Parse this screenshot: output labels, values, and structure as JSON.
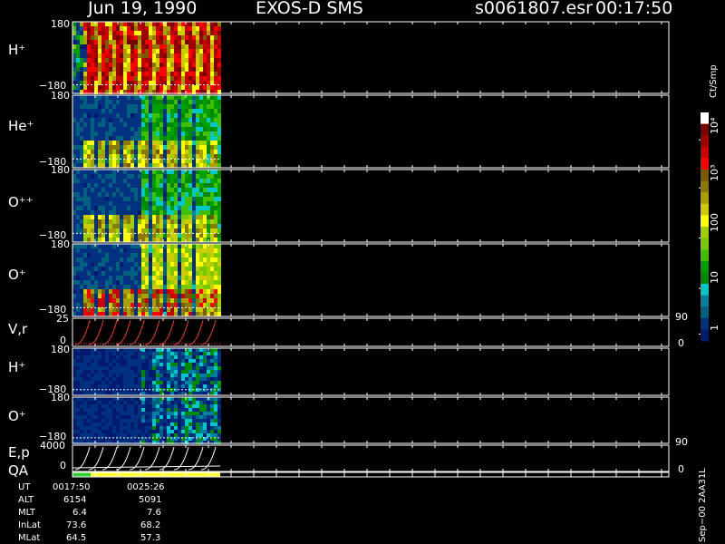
{
  "header": {
    "date": "Jun 19, 1990",
    "instrument": "EXOS-D SMS",
    "file": "s0061807.esr",
    "time": "00:17:50"
  },
  "colorbar": {
    "unit": "Ct/Smp",
    "labels": [
      "10⁴",
      "10³",
      "100",
      "10",
      "1"
    ],
    "colors": [
      "#ffffff",
      "#7a0000",
      "#a00000",
      "#cc0000",
      "#ff0000",
      "#7a5a00",
      "#8c7a00",
      "#aaa000",
      "#cccc00",
      "#ffff00",
      "#a0d000",
      "#7ac800",
      "#40c000",
      "#00a000",
      "#008800",
      "#00c8c8",
      "#0080a0",
      "#006080",
      "#003080",
      "#001a6e"
    ]
  },
  "panels": [
    {
      "id": "h-plus",
      "label": "H⁺",
      "ymax": "180",
      "ymin": "−180"
    },
    {
      "id": "he-plus",
      "label": "He⁺",
      "ymax": "180",
      "ymin": "−180"
    },
    {
      "id": "o-plusplus",
      "label": "O⁺⁺",
      "ymax": "180",
      "ymin": "−180"
    },
    {
      "id": "o-plus",
      "label": "O⁺",
      "ymax": "180",
      "ymin": "−180"
    },
    {
      "id": "vr",
      "label": "V,r",
      "ymax": "25",
      "ymin": "0",
      "rmax": "90",
      "rmin": "0"
    },
    {
      "id": "h-plus-2",
      "label": "H⁺",
      "ymax": "180",
      "ymin": "−180"
    },
    {
      "id": "o-plus-2",
      "label": "O⁺",
      "ymax": "180",
      "ymin": "−180"
    },
    {
      "id": "ep",
      "label": "E,p",
      "ymax": "4000",
      "ymin": "0",
      "rmax": "90",
      "rmin": "0"
    },
    {
      "id": "qa",
      "label": "QA"
    }
  ],
  "footer": {
    "rows": [
      {
        "name": "UT",
        "v1": "0017:50",
        "v2": "0025:26"
      },
      {
        "name": "ALT",
        "v1": "6154",
        "v2": "5091"
      },
      {
        "name": "MLT",
        "v1": "6.4",
        "v2": "7.6"
      },
      {
        "name": "InLat",
        "v1": "73.6",
        "v2": "68.2"
      },
      {
        "name": "MLat",
        "v1": "64.5",
        "v2": "57.3"
      }
    ],
    "stamp": "Sep−00 2AA31L"
  },
  "chart_data": {
    "type": "heatmap",
    "title": "Jun 19, 1990   EXOS-D SMS",
    "x_range_ut": [
      "0017:50",
      "0025:26"
    ],
    "series": [
      {
        "name": "H+",
        "ylim": [
          -180,
          180
        ]
      },
      {
        "name": "He+",
        "ylim": [
          -180,
          180
        ]
      },
      {
        "name": "O++",
        "ylim": [
          -180,
          180
        ]
      },
      {
        "name": "O+",
        "ylim": [
          -180,
          180
        ]
      },
      {
        "name": "V,r",
        "ylim": [
          0,
          25
        ],
        "right_ylim": [
          0,
          90
        ]
      },
      {
        "name": "H+",
        "ylim": [
          -180,
          180
        ]
      },
      {
        "name": "O+",
        "ylim": [
          -180,
          180
        ]
      },
      {
        "name": "E,p",
        "ylim": [
          0,
          4000
        ],
        "right_ylim": [
          0,
          90
        ]
      }
    ],
    "colorbar_range": [
      1,
      10000
    ],
    "colorbar_unit": "Ct/Smp"
  }
}
